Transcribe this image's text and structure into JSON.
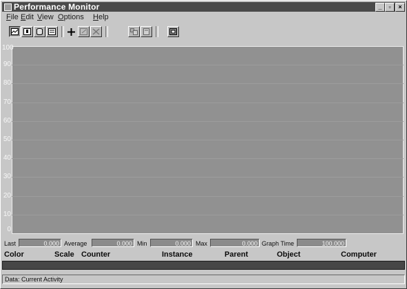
{
  "window": {
    "title": "Performance Monitor"
  },
  "caption_buttons": {
    "minimize": "_",
    "maximize": "▫",
    "close": "×"
  },
  "menubar": {
    "items": [
      {
        "mnemonic": "F",
        "rest": "ile"
      },
      {
        "mnemonic": "E",
        "rest": "dit"
      },
      {
        "mnemonic": "V",
        "rest": "iew"
      },
      {
        "mnemonic": "O",
        "rest": "ptions"
      },
      {
        "mnemonic": "H",
        "rest": "elp"
      }
    ]
  },
  "toolbar": {
    "buttons": [
      {
        "icon": "chart-view-icon",
        "pressed": true
      },
      {
        "icon": "alert-view-icon",
        "pressed": false
      },
      {
        "icon": "log-view-icon",
        "pressed": false
      },
      {
        "icon": "report-view-icon",
        "pressed": false
      },
      {
        "icon": "add-counter-icon",
        "pressed": false
      },
      {
        "icon": "edit-counter-icon",
        "pressed": false
      },
      {
        "icon": "delete-counter-icon",
        "pressed": false
      },
      {
        "icon": "update-now-icon",
        "pressed": false
      },
      {
        "icon": "bookmark-icon",
        "pressed": false
      },
      {
        "icon": "options-icon",
        "pressed": false
      }
    ]
  },
  "chart_data": {
    "type": "line",
    "y_ticks": [
      "100",
      "90",
      "80",
      "70",
      "60",
      "50",
      "40",
      "30",
      "20",
      "10",
      "0"
    ],
    "ylim": [
      0,
      100
    ],
    "grid": true,
    "series": []
  },
  "valuebar": {
    "last_label": "Last",
    "last_value": "0.000",
    "average_label": "Average",
    "average_value": "0.000",
    "min_label": "Min",
    "min_value": "0.000",
    "max_label": "Max",
    "max_value": "0.000",
    "graph_time_label": "Graph Time",
    "graph_time_value": "100.000"
  },
  "legend": {
    "columns": [
      "Color",
      "Scale",
      "Counter",
      "Instance",
      "Parent",
      "Object",
      "Computer"
    ]
  },
  "status": {
    "text": "Data: Current Activity"
  }
}
